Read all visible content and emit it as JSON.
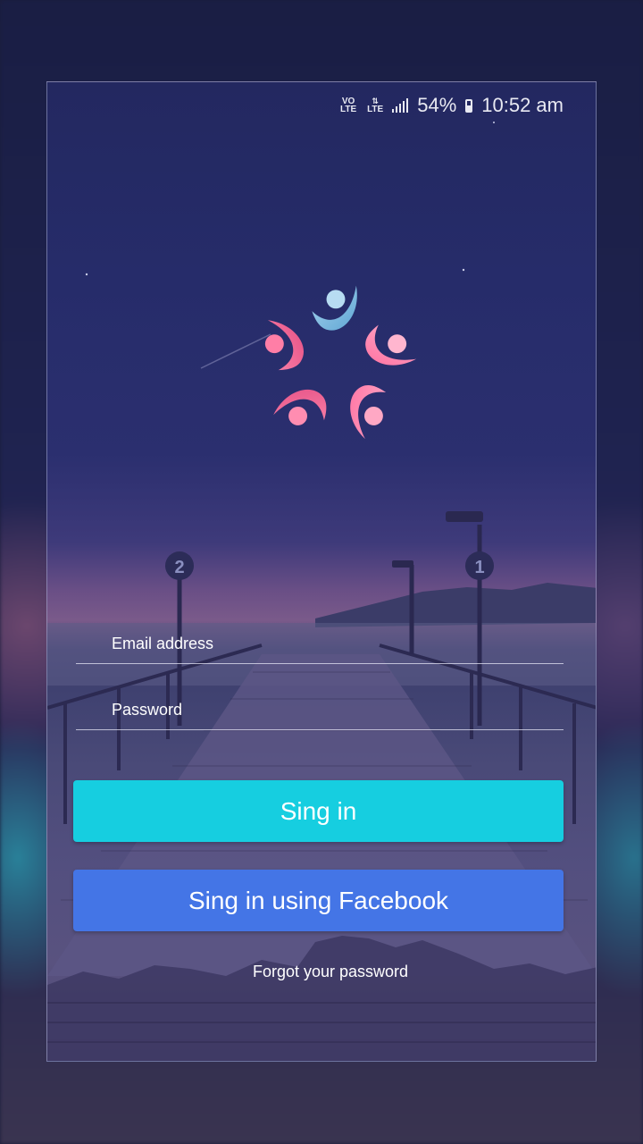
{
  "status_bar": {
    "volte_label": "VO LTE",
    "lte_label": "LTE",
    "battery_percent": "54%",
    "time": "10:52 am"
  },
  "login": {
    "email_placeholder": "Email address",
    "password_placeholder": "Password",
    "signin_label": "Sing in",
    "facebook_label": "Sing in using Facebook",
    "forgot_label": "Forgot your password"
  },
  "colors": {
    "signin_button": "#16cee0",
    "facebook_button": "#4475e6"
  },
  "icons": [
    "volte-icon",
    "lte-data-icon",
    "signal-icon",
    "battery-icon",
    "app-logo-icon"
  ]
}
